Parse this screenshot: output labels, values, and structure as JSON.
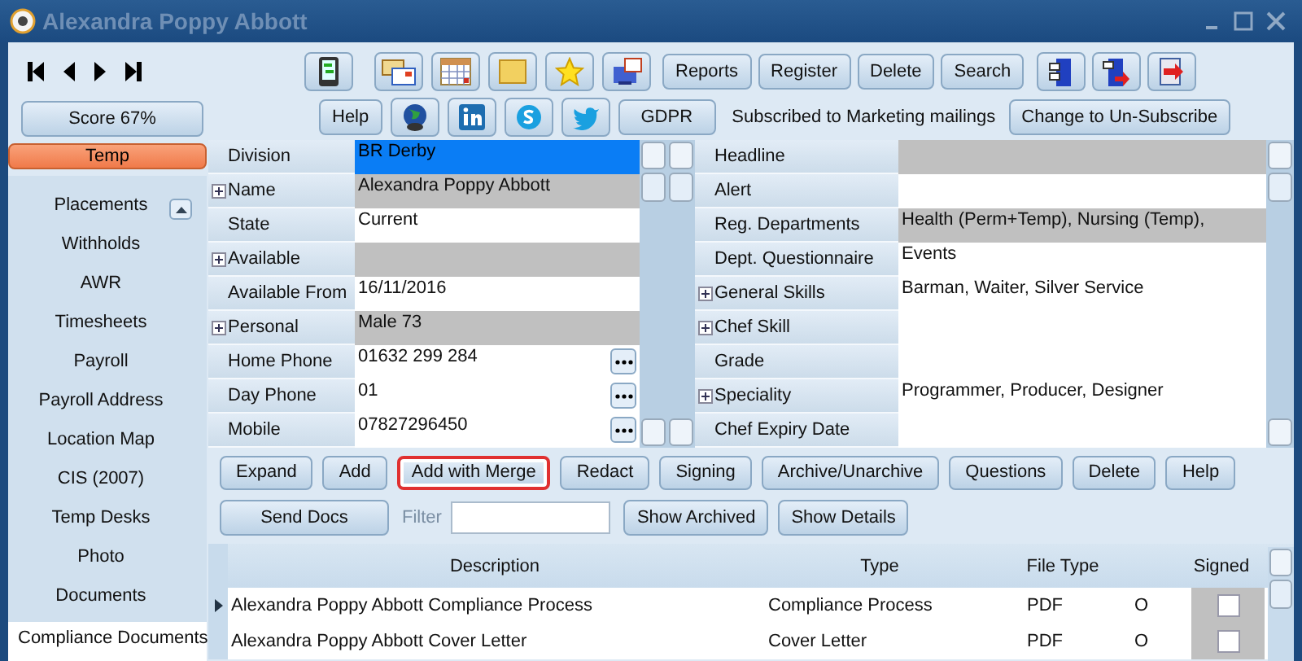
{
  "window": {
    "title": "Alexandra Poppy Abbott"
  },
  "toolbar": {
    "score_button": "Score 67%",
    "text_buttons": [
      "Reports",
      "Register",
      "Delete",
      "Search"
    ],
    "help_button": "Help",
    "gdpr_button": "GDPR",
    "subscription_status": "Subscribed to Marketing mailings",
    "subscribe_button": "Change to Un-Subscribe"
  },
  "sidebar": {
    "tab": {
      "label": "Temp",
      "selected": true
    },
    "items": [
      {
        "label": "Placements",
        "selected": false
      },
      {
        "label": "Withholds",
        "selected": false
      },
      {
        "label": "AWR",
        "selected": false
      },
      {
        "label": "Timesheets",
        "selected": false
      },
      {
        "label": "Payroll",
        "selected": false
      },
      {
        "label": "Payroll Address",
        "selected": false
      },
      {
        "label": "Location Map",
        "selected": false
      },
      {
        "label": "CIS (2007)",
        "selected": false
      },
      {
        "label": "Temp Desks",
        "selected": false
      },
      {
        "label": "Photo",
        "selected": false
      },
      {
        "label": "Documents",
        "selected": false
      },
      {
        "label": "Compliance Documents",
        "selected": true
      }
    ]
  },
  "details_left": [
    {
      "label": "Division",
      "value": "BR Derby",
      "kind": "highlighted",
      "expandable": false,
      "lookup": false
    },
    {
      "label": "Name",
      "value": "Alexandra Poppy Abbott",
      "kind": "readonly",
      "expandable": true,
      "lookup": false
    },
    {
      "label": "State",
      "value": "Current",
      "kind": "editable",
      "expandable": false,
      "lookup": false
    },
    {
      "label": "Available",
      "kind": "readonly",
      "expandable": true,
      "lookup": false
    },
    {
      "label": "Available From",
      "value": "16/11/2016",
      "kind": "editable",
      "expandable": false,
      "lookup": false
    },
    {
      "label": "Personal",
      "value": "Male 73",
      "kind": "readonly",
      "expandable": true,
      "lookup": false
    },
    {
      "label": "Home Phone",
      "value": "01632 299 284",
      "kind": "editable",
      "expandable": false,
      "lookup": true
    },
    {
      "label": "Day Phone",
      "value": "01",
      "kind": "editable",
      "expandable": false,
      "lookup": true
    },
    {
      "label": "Mobile",
      "value": "07827296450",
      "kind": "editable",
      "expandable": false,
      "lookup": true
    }
  ],
  "details_right": [
    {
      "label": "Headline",
      "kind": "readonly",
      "expandable": false
    },
    {
      "label": "Alert",
      "expandable": false
    },
    {
      "label": "Reg. Departments",
      "value": "Health (Perm+Temp), Nursing (Temp),",
      "kind": "readonly",
      "expandable": false
    },
    {
      "label": "Dept. Questionnaire",
      "value": "Events",
      "kind": "editable",
      "expandable": false
    },
    {
      "label": "General Skills",
      "value": "Barman, Waiter, Silver Service",
      "kind": "editable",
      "expandable": true
    },
    {
      "label": "Chef Skill",
      "expandable": true
    },
    {
      "label": "Grade",
      "expandable": false
    },
    {
      "label": "Speciality",
      "value": "Programmer, Producer, Designer",
      "kind": "editable",
      "expandable": true
    },
    {
      "label": "Chef Expiry Date",
      "expandable": false
    }
  ],
  "actions": [
    {
      "label": "Expand",
      "highlighted": false
    },
    {
      "label": "Add",
      "highlighted": false
    },
    {
      "label": "Add with Merge",
      "highlighted": true
    },
    {
      "label": "Redact",
      "highlighted": false
    },
    {
      "label": "Signing",
      "highlighted": false
    },
    {
      "label": "Archive/Unarchive",
      "highlighted": false
    },
    {
      "label": "Questions",
      "highlighted": false
    },
    {
      "label": "Delete",
      "highlighted": false
    },
    {
      "label": "Help",
      "highlighted": false
    }
  ],
  "actions_row2": {
    "send_button": "Send Docs",
    "filter_label": "Filter",
    "buttons": [
      "Show Archived",
      "Show Details"
    ]
  },
  "table": {
    "columns": [
      "Description",
      "Type",
      "File Type",
      "Signed"
    ],
    "rows": [
      {
        "current": true,
        "description": "Alexandra Poppy Abbott Compliance Process",
        "type": "Compliance Process",
        "file_type": "PDF",
        "column_4": "O",
        "signed": false
      },
      {
        "current": false,
        "description": "Alexandra Poppy Abbott Cover Letter",
        "type": "Cover Letter",
        "file_type": "PDF",
        "column_4": "O",
        "signed": false
      }
    ]
  }
}
